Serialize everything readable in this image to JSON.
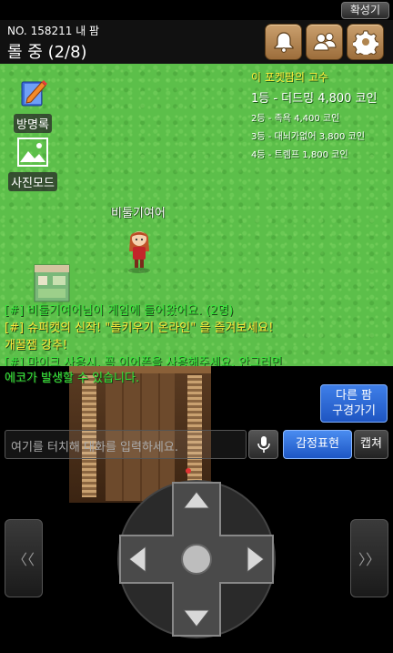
{
  "topbar": {
    "expand_label": "확성기"
  },
  "header": {
    "room_no": "NO. 158211 내 팜",
    "room_status": "롤 중 (2/8)",
    "icons": [
      "bell-icon",
      "friends-icon",
      "gear-icon"
    ]
  },
  "field": {
    "guestbook_label": "방명록",
    "photo_label": "사진모드",
    "character_name": "비둘기여어"
  },
  "ranking": {
    "title": "이 포켓팜의 고수",
    "first": "1등 - 더드밍 4,800 코인",
    "others": [
      "2등 - 족욕 4,400 코인",
      "3등 - 대뇌가없어 3,800 코인",
      "4등 - 트렘프 1,800 코인"
    ]
  },
  "chat": {
    "lines": [
      {
        "text": "[#] 비둘기여어님이 게임에 들어왔어요. (2명)",
        "kind": "sys"
      },
      {
        "text": "[#] 슈퍼캣의 신작! \"돌키우기 온라인\" 을 즐겨보세요!",
        "kind": "notice"
      },
      {
        "text": "개꿀잼 강추!",
        "kind": "notice"
      },
      {
        "text": "[#] 마이크 사용시, 꼭 이어폰을 사용해주세요. 안그러면",
        "kind": "sys"
      },
      {
        "text": "에코가 발생할 수 있습니다.",
        "kind": "sys"
      }
    ],
    "input_placeholder": "여기를 터치해 대화를 입력하세요."
  },
  "controls": {
    "other_room_line1": "다른 팜",
    "other_room_line2": "구경가기",
    "emote_label": "감정표현",
    "capture_label": "캡쳐",
    "prev_label": "〈〈",
    "next_label": "〉〉"
  },
  "colors": {
    "grass": "#5cbf4a",
    "system_text": "#36e63a",
    "notice_text": "#ffe83a",
    "accent_blue": "#1d56c4"
  }
}
